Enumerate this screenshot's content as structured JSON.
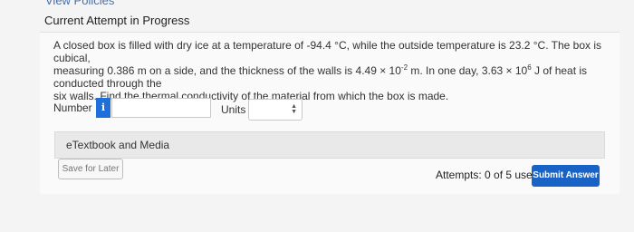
{
  "top_link": "View Policies",
  "attempt_title": "Current Attempt in Progress",
  "question": {
    "line1_a": "A closed box is filled with dry ice at a temperature of -94.4 °C, while the outside temperature is 23.2 °C. The box is cubical,",
    "line2_a": "measuring 0.386 m on a side, and the thickness of the walls is 4.49 × 10",
    "line2_exp1": "-2",
    "line2_b": " m. In one day, 3.63 × 10",
    "line2_exp2": "6",
    "line2_c": " J of heat is conducted through the",
    "line3": "six walls. Find the thermal conductivity of the material from which the box is made."
  },
  "answer": {
    "number_label": "Number",
    "info_icon_text": "i",
    "number_value": "",
    "units_label": "Units",
    "units_selected": ""
  },
  "etextbook_label": "eTextbook and Media",
  "save_label": "Save for Later",
  "attempts_text": "Attempts: 0 of 5 used",
  "submit_label": "Submit Answer"
}
